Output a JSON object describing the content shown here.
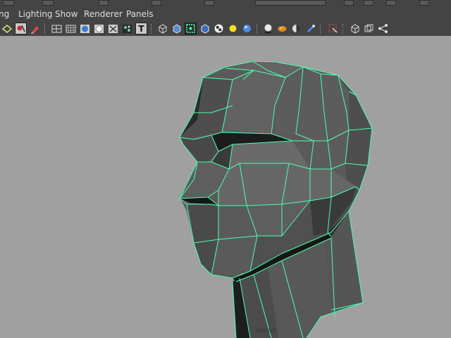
{
  "menu": {
    "items": [
      {
        "label": "ng"
      },
      {
        "label": "Lighting"
      },
      {
        "label": "Show"
      },
      {
        "label": "Renderer"
      },
      {
        "label": "Panels"
      }
    ]
  },
  "toolbar": {
    "icons": [
      "select-camera-icon",
      "bookmark-icon",
      "eraser-icon",
      "wireframe-mode-icon",
      "grid-icon",
      "smooth-shade-icon",
      "flat-shade-icon",
      "xray-icon",
      "texture-icon",
      "text-icon",
      "wireframe-cube-icon",
      "shaded-cube-icon",
      "isolate-icon",
      "default-material-icon",
      "checker-icon",
      "light-bulb-icon",
      "sphere-icon",
      "shadow-icon",
      "orange-blob-icon",
      "half-moon-icon",
      "cylinder-icon",
      "component-select-icon",
      "frame-icon",
      "multi-frame-icon",
      "share-icon"
    ],
    "text_icon_glyph": "T"
  },
  "viewport": {
    "camera_label": "persp",
    "background_color": "#a0a0a0",
    "mesh_fill_color": "#5a5a5a",
    "wire_color": "#4dffb0"
  }
}
